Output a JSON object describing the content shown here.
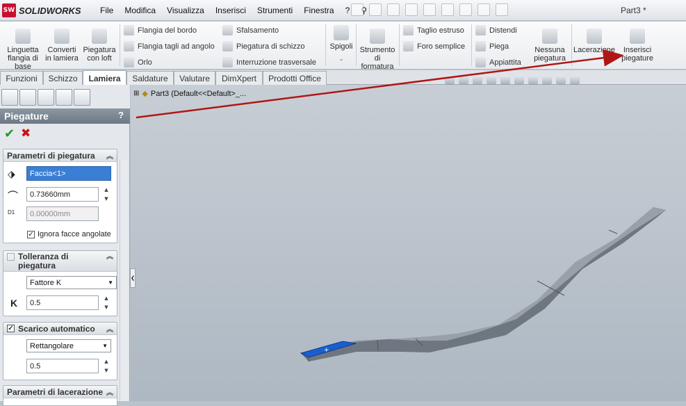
{
  "app": {
    "brand": "SOLIDWORKS",
    "brand_badge": "SW",
    "document_title": "Part3 *"
  },
  "menu": [
    "File",
    "Modifica",
    "Visualizza",
    "Inserisci",
    "Strumenti",
    "Finestra",
    "?"
  ],
  "ribbon": {
    "linguetta": "Linguetta flangia di base",
    "converti": "Converti in lamiera",
    "piegatura_loft": "Piegatura con loft",
    "flangia_bordo": "Flangia del bordo",
    "flangia_tagli": "Flangia tagli ad angolo",
    "orlo": "Orlo",
    "sfalsamento": "Sfalsamento",
    "piegatura_schizzo": "Piegatura di schizzo",
    "interruzione": "Interruzione trasversale",
    "spigoli": "Spigoli",
    "strumento_formatura": "Strumento di formatura",
    "taglio_estruso": "Taglio estruso",
    "foro_semplice": "Foro semplice",
    "distendi": "Distendi",
    "piega": "Piega",
    "appiattita": "Appiattita",
    "nessuna_piegatura": "Nessuna piegatura",
    "lacerazione": "Lacerazione",
    "inserisci_piegature": "Inserisci piegature"
  },
  "tabs": [
    "Funzioni",
    "Schizzo",
    "Lamiera",
    "Saldature",
    "Valutare",
    "DimXpert",
    "Prodotti Office"
  ],
  "active_tab": "Lamiera",
  "panel": {
    "title": "Piegature",
    "help": "?",
    "bend_params": {
      "header": "Parametri di piegatura",
      "face": "Faccia<1>",
      "radius": "0.73660mm",
      "d1": "0.00000mm",
      "d1_label": "D1",
      "ignore_label": "Ignora facce angolate",
      "ignore_checked": true
    },
    "tolerance": {
      "header": "Tolleranza di piegatura",
      "type": "Fattore K",
      "k_label": "K",
      "k_value": "0.5"
    },
    "relief": {
      "header": "Scarico automatico",
      "type": "Rettangolare",
      "value": "0.5"
    },
    "rip": {
      "header": "Parametri di lacerazione"
    }
  },
  "tree": {
    "label": "Part3  (Default<<Default>_..."
  },
  "colors": {
    "arrow": "#b01616",
    "selected_face": "#1a5fd0",
    "brand_red": "#c8102e"
  }
}
